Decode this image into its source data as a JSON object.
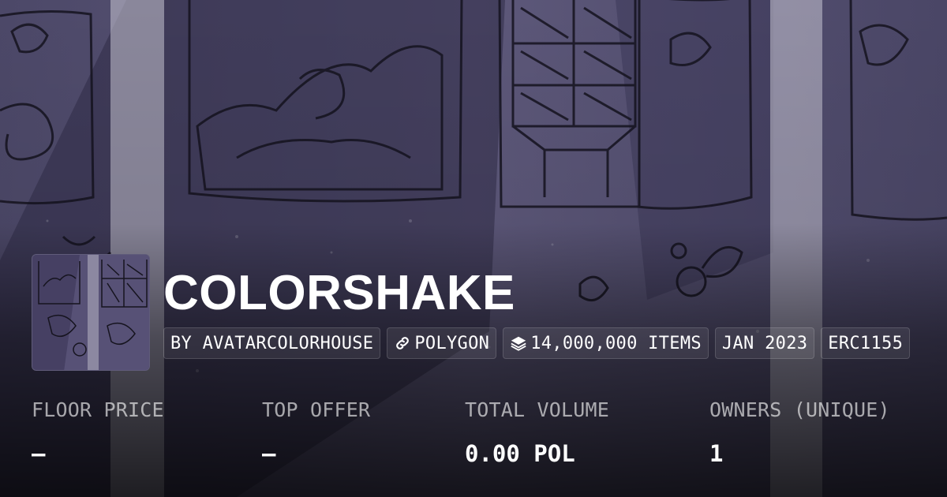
{
  "collection": {
    "name": "COLORSHAKE",
    "creator": "BY AVATARCOLORHOUSE",
    "chain": "POLYGON",
    "items": "14,000,000 ITEMS",
    "created": "JAN 2023",
    "standard": "ERC1155"
  },
  "stats": [
    {
      "label": "FLOOR PRICE",
      "value": "–"
    },
    {
      "label": "TOP OFFER",
      "value": "–"
    },
    {
      "label": "TOTAL VOLUME",
      "value": "0.00 POL"
    },
    {
      "label": "OWNERS (UNIQUE)",
      "value": "1"
    }
  ],
  "icons": {
    "chain": "link-icon",
    "items": "layers-icon"
  },
  "colors": {
    "banner_tint": "#5b5577",
    "text": "#ffffff",
    "muted_text": "#a8a6b5"
  }
}
